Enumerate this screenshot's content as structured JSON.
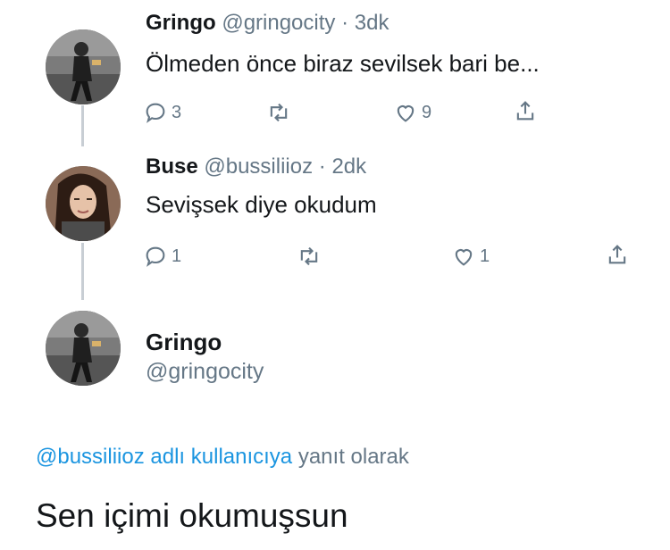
{
  "tweet1": {
    "name": "Gringo",
    "handle": "@gringocity",
    "dot": "·",
    "time": "3dk",
    "text": "Ölmeden önce biraz sevilsek bari be...",
    "reply_count": "3",
    "retweet_count": "",
    "like_count": "9"
  },
  "tweet2": {
    "name": "Buse",
    "handle": "@bussiliioz",
    "dot": "·",
    "time": "2dk",
    "text": "Sevişsek diye okudum",
    "reply_count": "1",
    "retweet_count": "",
    "like_count": "1"
  },
  "main_tweet": {
    "name": "Gringo",
    "handle": "@gringocity",
    "reply_mention": "@bussiliioz adlı kullanıcıya",
    "reply_suffix": "yanıt olarak",
    "text": "Sen içimi okumuşsun"
  },
  "colors": {
    "text": "#14171a",
    "muted": "#657786",
    "link": "#1b95e0",
    "thread_line": "#c8ced4"
  },
  "icons": [
    "reply-icon",
    "retweet-icon",
    "like-icon",
    "share-icon"
  ]
}
